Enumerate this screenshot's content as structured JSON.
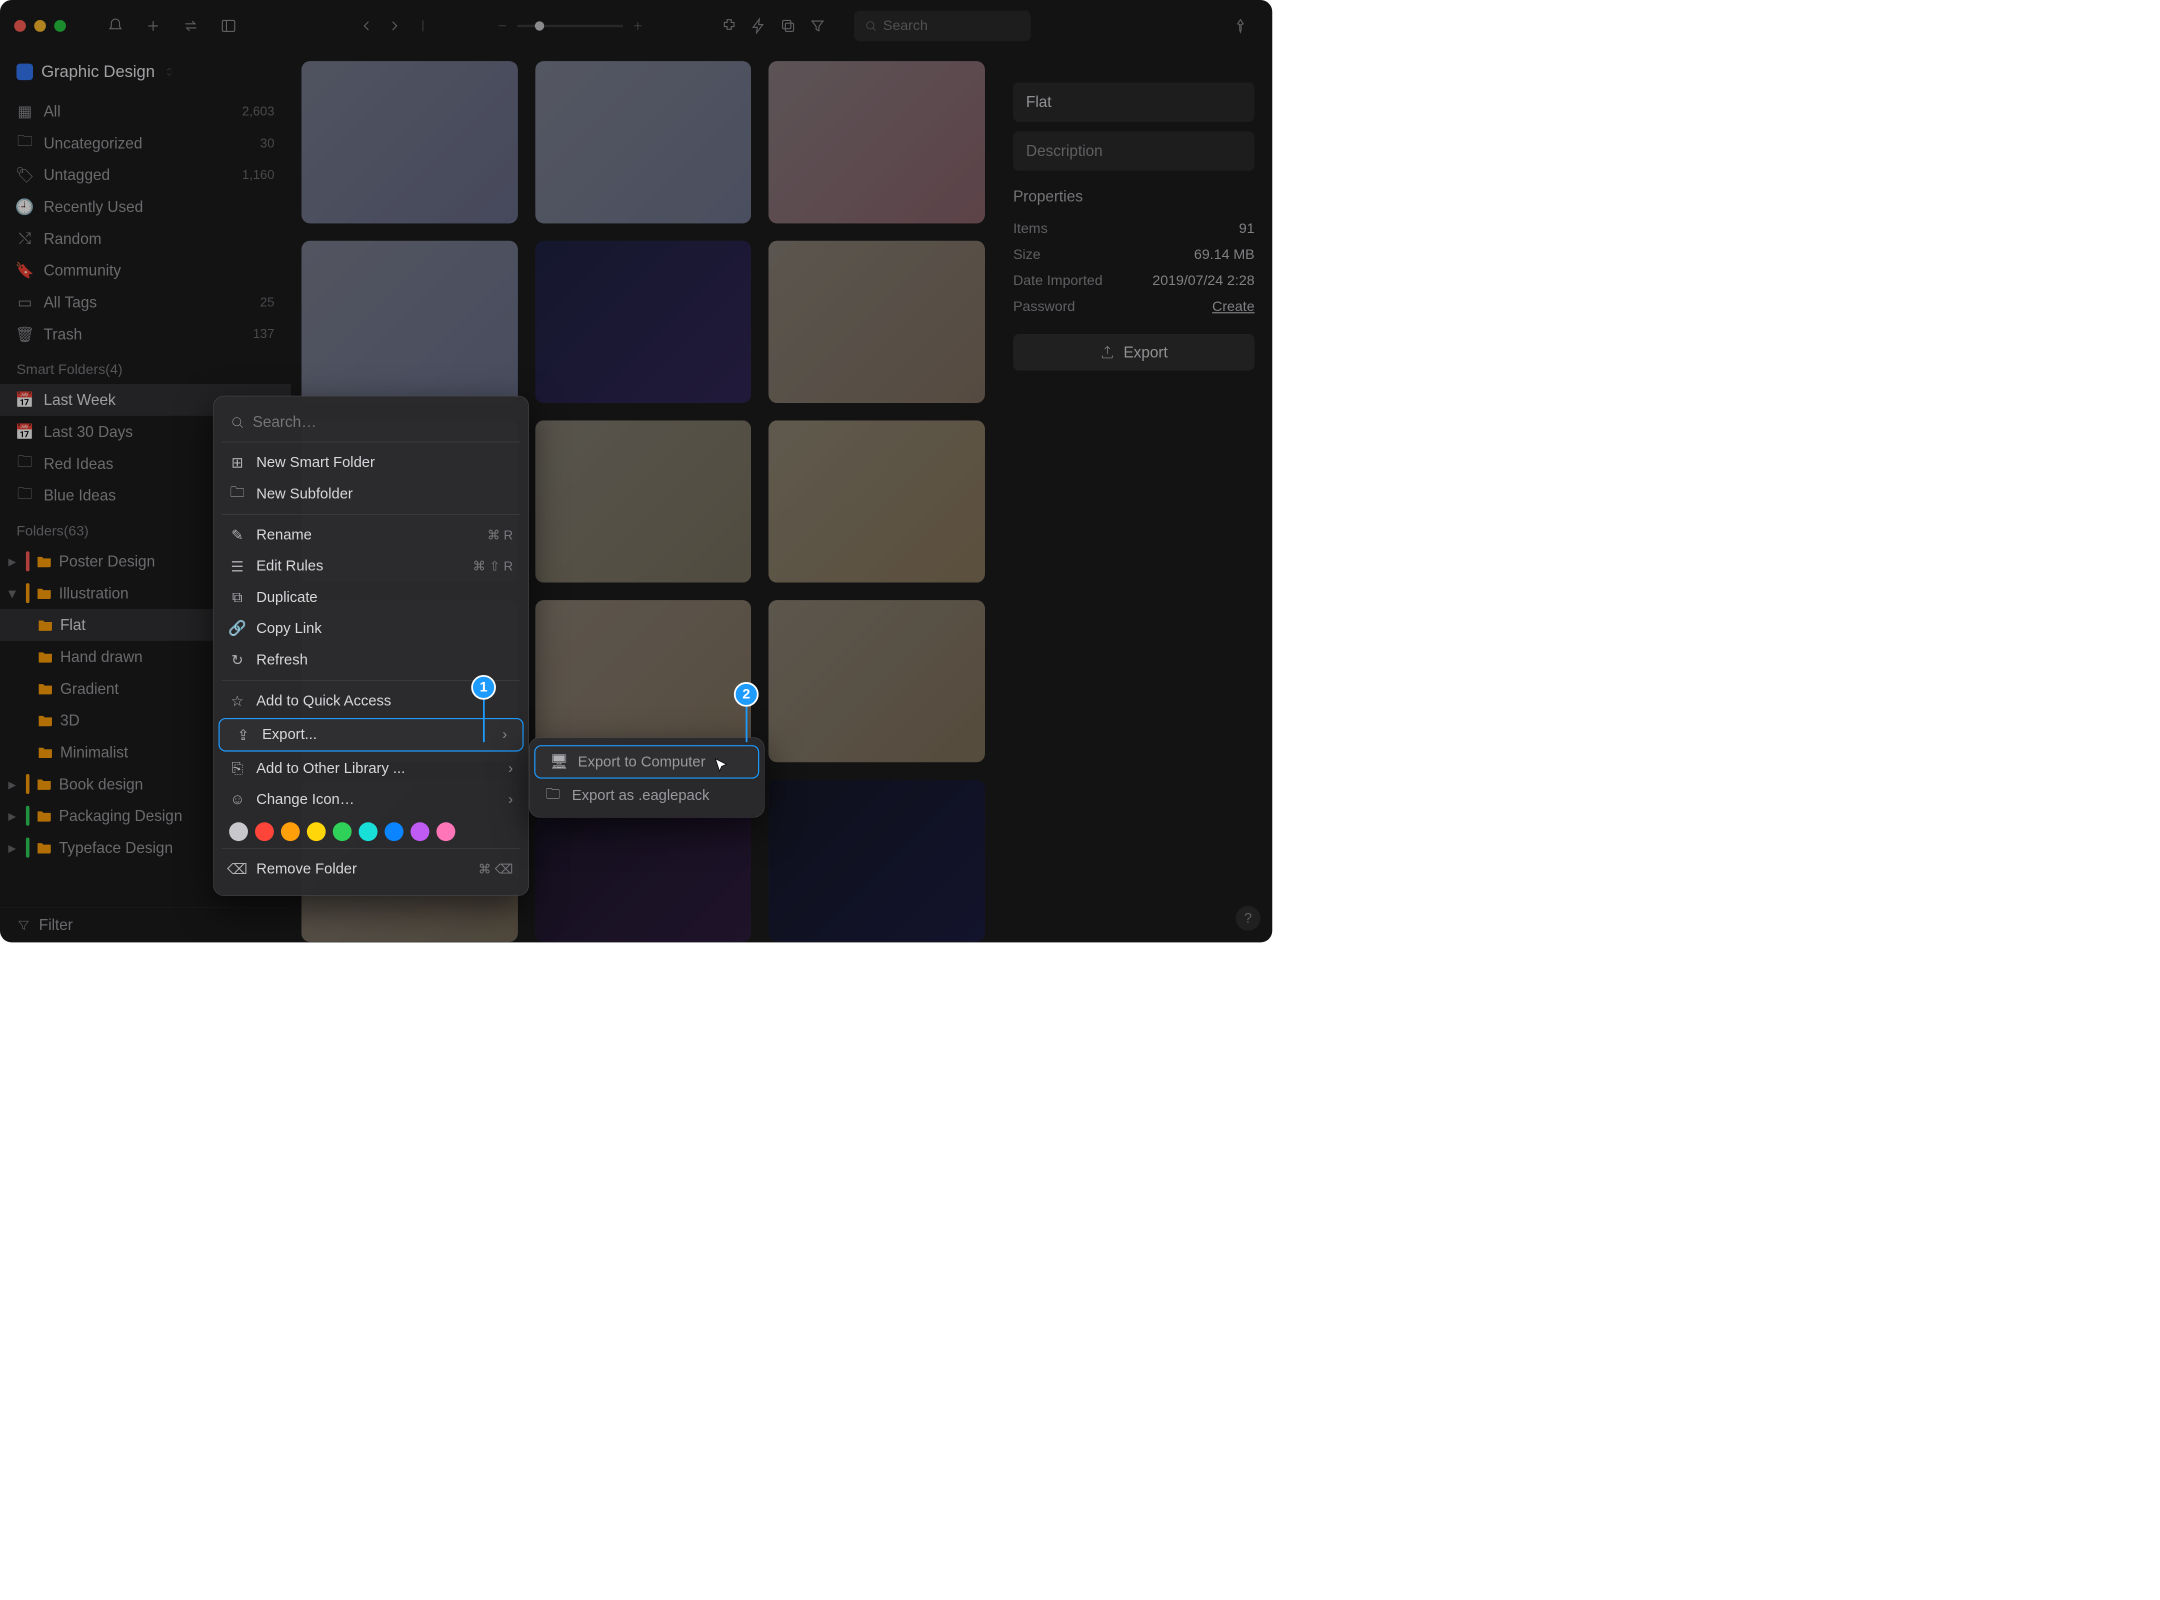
{
  "library": {
    "name": "Graphic Design"
  },
  "search": {
    "placeholder": "Search"
  },
  "sidebar": {
    "items": [
      {
        "label": "All",
        "count": "2,603"
      },
      {
        "label": "Uncategorized",
        "count": "30"
      },
      {
        "label": "Untagged",
        "count": "1,160"
      },
      {
        "label": "Recently Used",
        "count": ""
      },
      {
        "label": "Random",
        "count": ""
      },
      {
        "label": "Community",
        "count": ""
      },
      {
        "label": "All Tags",
        "count": "25"
      },
      {
        "label": "Trash",
        "count": "137"
      }
    ],
    "smart_header": "Smart Folders(4)",
    "smart": [
      {
        "label": "Last Week"
      },
      {
        "label": "Last 30 Days"
      },
      {
        "label": "Red Ideas"
      },
      {
        "label": "Blue Ideas"
      }
    ],
    "folders_header": "Folders(63)",
    "folders": [
      {
        "label": "Poster Design",
        "color": "#ff5a5a"
      },
      {
        "label": "Illustration",
        "color": "#ff9f0a",
        "open": true,
        "children": [
          {
            "label": "Flat"
          },
          {
            "label": "Hand drawn"
          },
          {
            "label": "Gradient"
          },
          {
            "label": "3D"
          },
          {
            "label": "Minimalist"
          }
        ]
      },
      {
        "label": "Book design",
        "color": "#ff9f0a"
      },
      {
        "label": "Packaging Design",
        "color": "#30d158"
      },
      {
        "label": "Typeface Design",
        "color": "#30d158"
      }
    ],
    "filter": "Filter"
  },
  "inspector": {
    "title": "Flat",
    "description": "Description",
    "properties_label": "Properties",
    "props": [
      {
        "k": "Items",
        "v": "91"
      },
      {
        "k": "Size",
        "v": "69.14 MB"
      },
      {
        "k": "Date Imported",
        "v": "2019/07/24 2:28"
      },
      {
        "k": "Password",
        "v": "Create",
        "link": true
      }
    ],
    "export": "Export"
  },
  "ctx": {
    "search_placeholder": "Search…",
    "items_a": [
      {
        "label": "New Smart Folder"
      },
      {
        "label": "New Subfolder"
      }
    ],
    "items_b": [
      {
        "label": "Rename",
        "short": "⌘ R"
      },
      {
        "label": "Edit Rules",
        "short": "⌘ ⇧ R"
      },
      {
        "label": "Duplicate"
      },
      {
        "label": "Copy Link"
      },
      {
        "label": "Refresh"
      }
    ],
    "items_c": [
      {
        "label": "Add to Quick Access"
      }
    ],
    "export": "Export...",
    "items_d": [
      {
        "label": "Add to Other Library ...",
        "sub": true
      },
      {
        "label": "Change Icon…",
        "sub": true
      }
    ],
    "remove": "Remove Folder",
    "remove_short": "⌘ ⌫",
    "colors": [
      "#c8c8cc",
      "#ff453a",
      "#ff9f0a",
      "#ffd60a",
      "#30d158",
      "#18e0d8",
      "#0a84ff",
      "#bf5af2",
      "#ff75b8"
    ]
  },
  "sub": {
    "items": [
      {
        "label": "Export to Computer"
      },
      {
        "label": "Export as .eaglepack"
      }
    ]
  },
  "badges": {
    "one": "1",
    "two": "2"
  }
}
